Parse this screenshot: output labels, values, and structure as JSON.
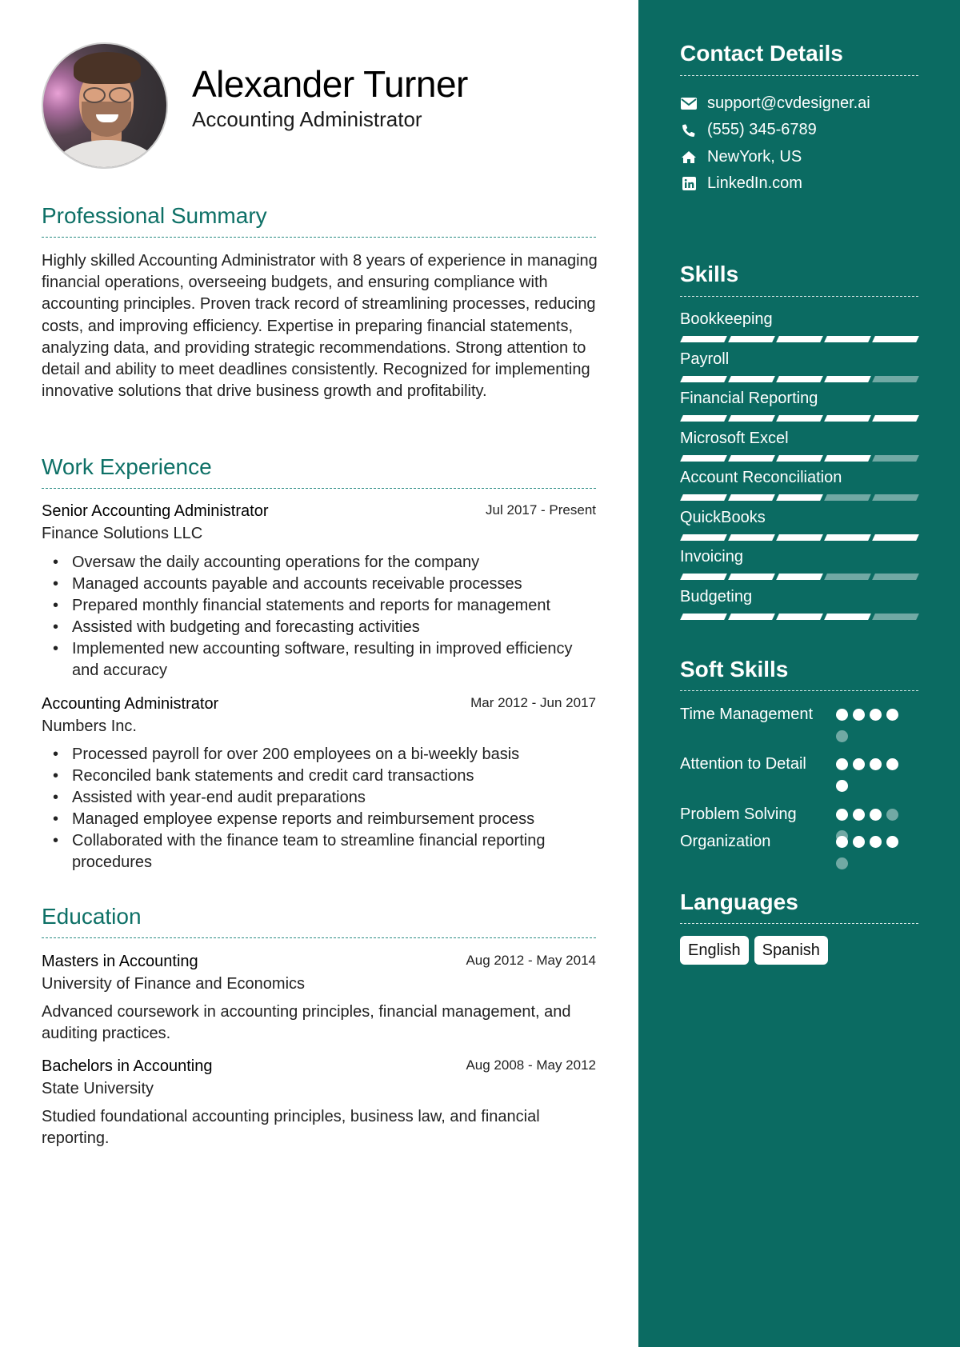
{
  "header": {
    "name": "Alexander Turner",
    "title": "Accounting Administrator",
    "photo_icon": "profile-photo"
  },
  "summary": {
    "heading": "Professional Summary",
    "text": "Highly skilled Accounting Administrator with 8 years of experience in managing financial operations, overseeing budgets, and ensuring compliance with accounting principles. Proven track record of streamlining processes, reducing costs, and improving efficiency. Expertise in preparing financial statements, analyzing data, and providing strategic recommendations. Strong attention to detail and ability to meet deadlines consistently. Recognized for implementing innovative solutions that drive business growth and profitability."
  },
  "experience": {
    "heading": "Work Experience",
    "jobs": [
      {
        "role": "Senior Accounting Administrator",
        "company": "Finance Solutions LLC",
        "dates": "Jul 2017 - Present",
        "bullets": [
          "Oversaw the daily accounting operations for the company",
          "Managed accounts payable and accounts receivable processes",
          "Prepared monthly financial statements and reports for management",
          "Assisted with budgeting and forecasting activities",
          "Implemented new accounting software, resulting in improved efficiency and accuracy"
        ]
      },
      {
        "role": "Accounting Administrator",
        "company": "Numbers Inc.",
        "dates": "Mar 2012 - Jun 2017",
        "bullets": [
          "Processed payroll for over 200 employees on a bi-weekly basis",
          "Reconciled bank statements and credit card transactions",
          "Assisted with year-end audit preparations",
          "Managed employee expense reports and reimbursement process",
          "Collaborated with the finance team to streamline financial reporting procedures"
        ]
      }
    ]
  },
  "education": {
    "heading": "Education",
    "items": [
      {
        "degree": "Masters in Accounting",
        "school": "University of Finance and Economics",
        "dates": "Aug 2012 - May 2014",
        "description": "Advanced coursework in accounting principles, financial management, and auditing practices."
      },
      {
        "degree": "Bachelors in Accounting",
        "school": "State University",
        "dates": "Aug 2008 - May 2012",
        "description": "Studied foundational accounting principles, business law, and financial reporting."
      }
    ]
  },
  "contact": {
    "heading": "Contact Details",
    "items": [
      {
        "icon": "envelope-icon",
        "text": "support@cvdesigner.ai"
      },
      {
        "icon": "phone-icon",
        "text": "(555) 345-6789"
      },
      {
        "icon": "home-icon",
        "text": "NewYork, US"
      },
      {
        "icon": "linkedin-icon",
        "text": "LinkedIn.com"
      }
    ]
  },
  "skills": {
    "heading": "Skills",
    "max": 5,
    "items": [
      {
        "name": "Bookkeeping",
        "level": 5
      },
      {
        "name": "Payroll",
        "level": 4
      },
      {
        "name": "Financial Reporting",
        "level": 5
      },
      {
        "name": "Microsoft Excel",
        "level": 4
      },
      {
        "name": "Account Reconciliation",
        "level": 3
      },
      {
        "name": "QuickBooks",
        "level": 5
      },
      {
        "name": "Invoicing",
        "level": 3
      },
      {
        "name": "Budgeting",
        "level": 4
      }
    ]
  },
  "soft_skills": {
    "heading": "Soft Skills",
    "max": 5,
    "items": [
      {
        "name": "Time Management",
        "level": 4
      },
      {
        "name": "Attention to Detail",
        "level": 5
      },
      {
        "name": "Problem Solving",
        "level": 3
      },
      {
        "name": "Organization",
        "level": 4
      }
    ]
  },
  "languages": {
    "heading": "Languages",
    "items": [
      "English",
      "Spanish"
    ]
  },
  "colors": {
    "accent": "#0b6b62",
    "heading_teal": "#0d7066"
  }
}
